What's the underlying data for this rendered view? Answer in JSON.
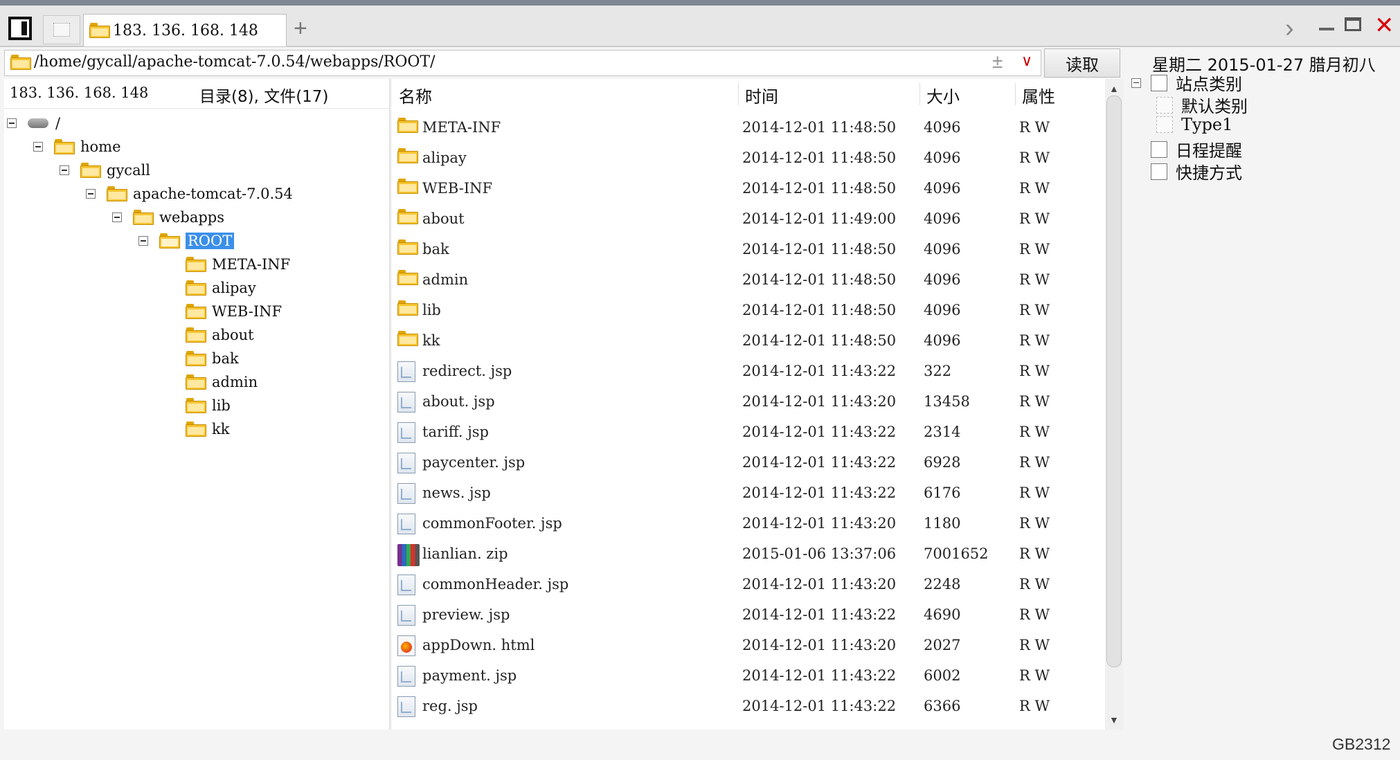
{
  "tabs": [
    {
      "label": "183. 136. 168. 148",
      "active": true
    }
  ],
  "tab_add_label": "+",
  "address": {
    "path": "/home/gycall/apache-tomcat-7.0.54/webapps/ROOT/",
    "plus_icon": "±"
  },
  "read_button": "读取",
  "date_display": "星期二  2015-01-27  腊月初八",
  "left": {
    "ip": "183. 136. 168. 148",
    "summary": "目录(8), 文件(17)",
    "tree": [
      {
        "label": "/",
        "level": 0,
        "icon": "drive-icon",
        "toggle": true
      },
      {
        "label": "home",
        "level": 1,
        "icon": "folder-icon",
        "toggle": true
      },
      {
        "label": "gycall",
        "level": 2,
        "icon": "folder-icon",
        "toggle": true
      },
      {
        "label": "apache-tomcat-7.0.54",
        "level": 3,
        "icon": "folder-icon",
        "toggle": true
      },
      {
        "label": "webapps",
        "level": 4,
        "icon": "folder-icon",
        "toggle": true
      },
      {
        "label": "ROOT",
        "level": 5,
        "icon": "folder-open-icon",
        "toggle": true,
        "selected": true
      },
      {
        "label": "META-INF",
        "level": 6,
        "icon": "folder-icon"
      },
      {
        "label": "alipay",
        "level": 6,
        "icon": "folder-icon"
      },
      {
        "label": "WEB-INF",
        "level": 6,
        "icon": "folder-icon"
      },
      {
        "label": "about",
        "level": 6,
        "icon": "folder-icon"
      },
      {
        "label": "bak",
        "level": 6,
        "icon": "folder-icon"
      },
      {
        "label": "admin",
        "level": 6,
        "icon": "folder-icon"
      },
      {
        "label": "lib",
        "level": 6,
        "icon": "folder-icon"
      },
      {
        "label": "kk",
        "level": 6,
        "icon": "folder-icon"
      }
    ]
  },
  "list": {
    "columns": [
      "名称",
      "时间",
      "大小",
      "属性"
    ],
    "rows": [
      {
        "name": "META-INF",
        "time": "2014-12-01 11:48:50",
        "size": "4096",
        "attr": "R W",
        "type": "folder"
      },
      {
        "name": "alipay",
        "time": "2014-12-01 11:48:50",
        "size": "4096",
        "attr": "R W",
        "type": "folder"
      },
      {
        "name": "WEB-INF",
        "time": "2014-12-01 11:48:50",
        "size": "4096",
        "attr": "R W",
        "type": "folder"
      },
      {
        "name": "about",
        "time": "2014-12-01 11:49:00",
        "size": "4096",
        "attr": "R W",
        "type": "folder"
      },
      {
        "name": "bak",
        "time": "2014-12-01 11:48:50",
        "size": "4096",
        "attr": "R W",
        "type": "folder"
      },
      {
        "name": "admin",
        "time": "2014-12-01 11:48:50",
        "size": "4096",
        "attr": "R W",
        "type": "folder"
      },
      {
        "name": "lib",
        "time": "2014-12-01 11:48:50",
        "size": "4096",
        "attr": "R W",
        "type": "folder"
      },
      {
        "name": "kk",
        "time": "2014-12-01 11:48:50",
        "size": "4096",
        "attr": "R W",
        "type": "folder"
      },
      {
        "name": "redirect. jsp",
        "time": "2014-12-01 11:43:22",
        "size": "322",
        "attr": "R W",
        "type": "jsp"
      },
      {
        "name": "about. jsp",
        "time": "2014-12-01 11:43:20",
        "size": "13458",
        "attr": "R W",
        "type": "jsp"
      },
      {
        "name": "tariff. jsp",
        "time": "2014-12-01 11:43:22",
        "size": "2314",
        "attr": "R W",
        "type": "jsp"
      },
      {
        "name": "paycenter. jsp",
        "time": "2014-12-01 11:43:22",
        "size": "6928",
        "attr": "R W",
        "type": "jsp"
      },
      {
        "name": "news. jsp",
        "time": "2014-12-01 11:43:22",
        "size": "6176",
        "attr": "R W",
        "type": "jsp"
      },
      {
        "name": "commonFooter. jsp",
        "time": "2014-12-01 11:43:20",
        "size": "1180",
        "attr": "R W",
        "type": "jsp"
      },
      {
        "name": "lianlian. zip",
        "time": "2015-01-06 13:37:06",
        "size": "7001652",
        "attr": "R W",
        "type": "zip"
      },
      {
        "name": "commonHeader. jsp",
        "time": "2014-12-01 11:43:20",
        "size": "2248",
        "attr": "R W",
        "type": "jsp"
      },
      {
        "name": "preview. jsp",
        "time": "2014-12-01 11:43:22",
        "size": "4690",
        "attr": "R W",
        "type": "jsp"
      },
      {
        "name": "appDown. html",
        "time": "2014-12-01 11:43:20",
        "size": "2027",
        "attr": "R W",
        "type": "html"
      },
      {
        "name": "payment. jsp",
        "time": "2014-12-01 11:43:22",
        "size": "6002",
        "attr": "R W",
        "type": "jsp"
      },
      {
        "name": "reg. jsp",
        "time": "2014-12-01 11:43:22",
        "size": "6366",
        "attr": "R W",
        "type": "jsp"
      }
    ]
  },
  "right": {
    "items": [
      {
        "label": "站点类别",
        "indent": 0,
        "toggle": true,
        "icon": "category-icon"
      },
      {
        "label": "默认类别",
        "indent": 1,
        "toggle": false,
        "icon": "category-item-icon"
      },
      {
        "label": "Type1",
        "indent": 1,
        "toggle": false,
        "icon": "category-item-icon"
      },
      {
        "label": "日程提醒",
        "indent": 0,
        "toggle": false,
        "icon": "schedule-icon"
      },
      {
        "label": "快捷方式",
        "indent": 0,
        "toggle": false,
        "icon": "shortcut-icon"
      }
    ]
  },
  "encoding": "GB2312",
  "colors": {
    "selection": "#3b8fea",
    "close": "#d8000a",
    "folder": "#f6c431"
  }
}
